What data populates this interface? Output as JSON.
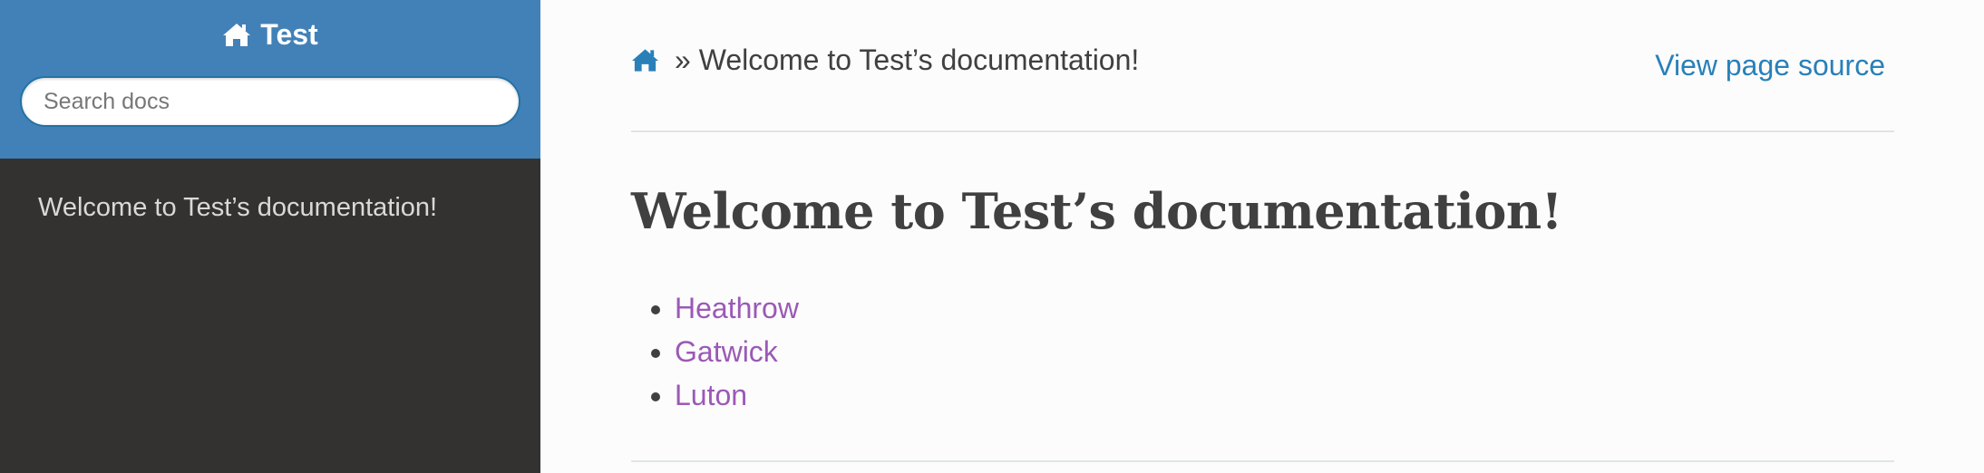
{
  "sidebar": {
    "project_name": "Test",
    "search_placeholder": "Search docs",
    "nav_items": [
      "Welcome to Test’s documentation!"
    ]
  },
  "breadcrumbs": {
    "separator_text": "» Welcome to Test’s documentation!",
    "view_source_label": "View page source"
  },
  "main": {
    "title": "Welcome to Test’s documentation!",
    "links": [
      "Heathrow",
      "Gatwick",
      "Luton"
    ]
  },
  "colors": {
    "sidebar_header": "#4281b8",
    "sidebar_body": "#343131",
    "link": "#2980b9",
    "visited_link": "#9b59b6",
    "text": "#404040"
  },
  "icons": {
    "project": "home-icon",
    "breadcrumb_home": "home-icon"
  }
}
